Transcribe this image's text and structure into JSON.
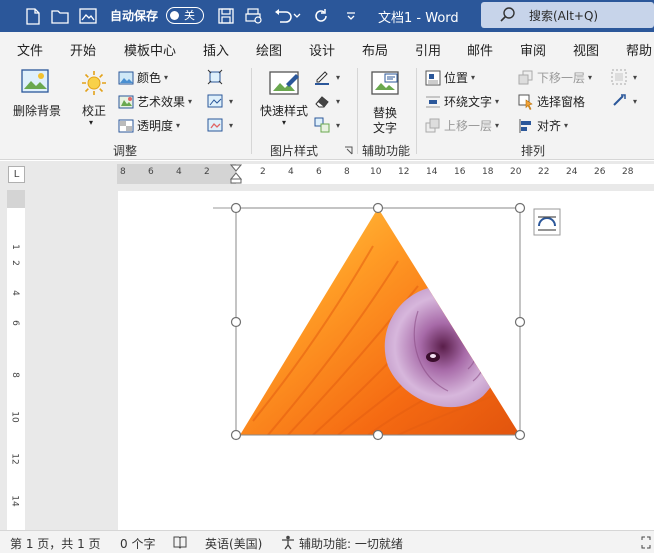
{
  "titlebar": {
    "autosave_label": "自动保存",
    "autosave_state": "关",
    "doc_title": "文档1  -  Word",
    "search_placeholder": "搜索(Alt+Q)"
  },
  "menu": {
    "tabs": [
      "文件",
      "开始",
      "模板中心",
      "插入",
      "绘图",
      "设计",
      "布局",
      "引用",
      "邮件",
      "审阅",
      "视图",
      "帮助"
    ]
  },
  "ribbon": {
    "adjust": {
      "remove_bg": "删除背景",
      "correct": "校正",
      "color": "颜色",
      "art_effects": "艺术效果",
      "transparency": "透明度",
      "group_label": "调整"
    },
    "picture_styles": {
      "quick_styles": "快速样式",
      "group_label": "图片样式"
    },
    "accessibility": {
      "alt_text": "替换",
      "alt_text_2": "文字",
      "group_label": "辅助功能"
    },
    "arrange": {
      "position": "位置",
      "wrap_text": "环绕文字",
      "bring_forward": "上移一层",
      "send_backward": "下移一层",
      "selection_pane": "选择窗格",
      "align": "对齐",
      "group_label": "排列"
    }
  },
  "ruler": {
    "h_numbers": [
      "8",
      "6",
      "4",
      "2",
      "2",
      "4",
      "6",
      "8",
      "10",
      "12",
      "14",
      "16",
      "18",
      "20",
      "22",
      "24",
      "26",
      "28"
    ],
    "v_numbers": [
      "1",
      "2",
      "4",
      "6",
      "8",
      "10",
      "12",
      "14"
    ],
    "corner_symbol": "L"
  },
  "statusbar": {
    "page_info": "第 1 页，共 1 页",
    "word_count": "0 个字",
    "language": "英语(美国)",
    "accessibility": "辅助功能: 一切就绪"
  },
  "colors": {
    "titlebar": "#2b579a",
    "ribbon": "#f3f3f3",
    "accent": "#2b579a"
  }
}
